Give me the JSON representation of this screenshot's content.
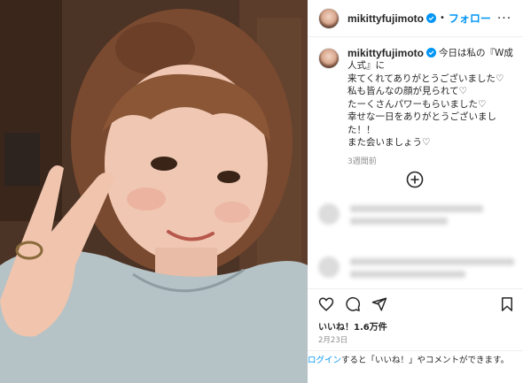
{
  "post": {
    "username": "mikittyfujimoto",
    "follow_label": "フォロー",
    "dot": "•",
    "more_label": "···",
    "caption_first": "今日は私の『W成",
    "caption_rest": "人式』に\n来てくれてありがとうございました♡\n私も皆んなの顔が見られて♡\nたーくさんパワーもらいました♡\n幸せな一日をありがとうございました！！\nまた会いましょう♡",
    "time_ago": "3週間前",
    "likes": "いいね！1.6万件",
    "date": "2月23日",
    "login_link": "ログイン",
    "login_text": "すると「いいね！」やコメントができます。"
  },
  "icons": {
    "verified": "verified-badge-icon",
    "more": "more-options-icon",
    "load_more": "plus-circle-icon",
    "like": "heart-icon",
    "comment": "comment-icon",
    "share": "share-icon",
    "save": "bookmark-icon"
  },
  "colors": {
    "accent": "#0095f6",
    "text": "#262626",
    "muted": "#8e8e8e",
    "border": "#efefef"
  }
}
